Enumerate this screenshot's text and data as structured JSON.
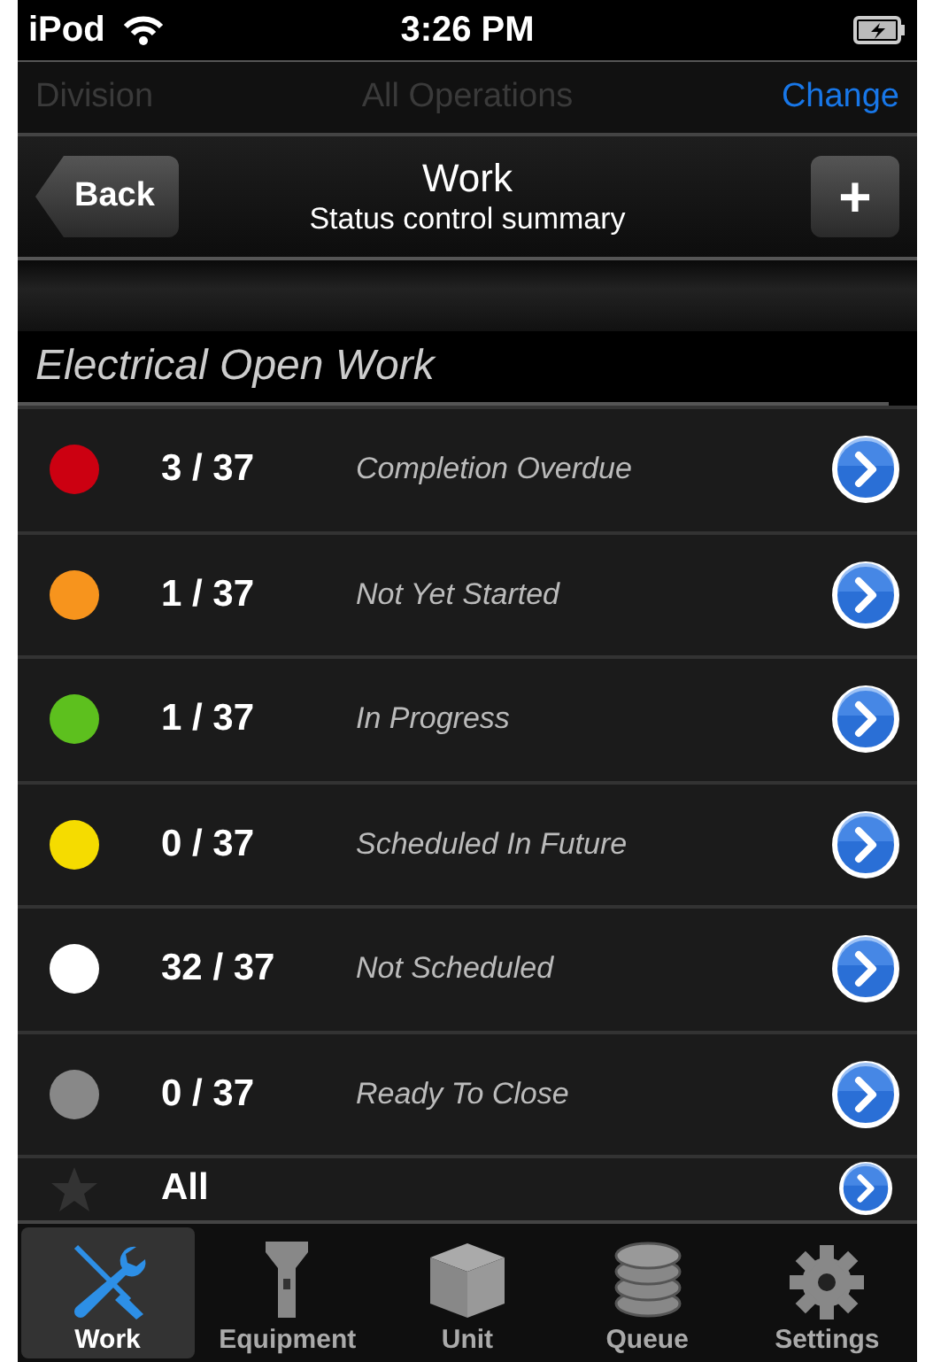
{
  "status_bar": {
    "carrier": "iPod",
    "time": "3:26 PM"
  },
  "division_bar": {
    "label": "Division",
    "value": "All Operations",
    "action": "Change"
  },
  "nav_bar": {
    "back": "Back",
    "title": "Work",
    "subtitle": "Status control summary",
    "add": "+"
  },
  "section": {
    "title": "Electrical Open Work"
  },
  "rows": [
    {
      "kind": "status",
      "color": "#cc0011",
      "count": "3 / 37",
      "label": "Completion Overdue"
    },
    {
      "kind": "status",
      "color": "#f7941d",
      "count": "1 / 37",
      "label": "Not Yet Started"
    },
    {
      "kind": "status",
      "color": "#5dc01e",
      "count": "1 / 37",
      "label": "In Progress"
    },
    {
      "kind": "status",
      "color": "#f5dc00",
      "count": "0 / 37",
      "label": "Scheduled In Future"
    },
    {
      "kind": "status",
      "color": "#ffffff",
      "count": "32 / 37",
      "label": "Not Scheduled"
    },
    {
      "kind": "status",
      "color": "#888888",
      "count": "0 / 37",
      "label": "Ready To Close"
    },
    {
      "kind": "all",
      "count": "All"
    }
  ],
  "tabs": [
    {
      "label": "Work",
      "selected": true
    },
    {
      "label": "Equipment",
      "selected": false
    },
    {
      "label": "Unit",
      "selected": false
    },
    {
      "label": "Queue",
      "selected": false
    },
    {
      "label": "Settings",
      "selected": false
    }
  ]
}
